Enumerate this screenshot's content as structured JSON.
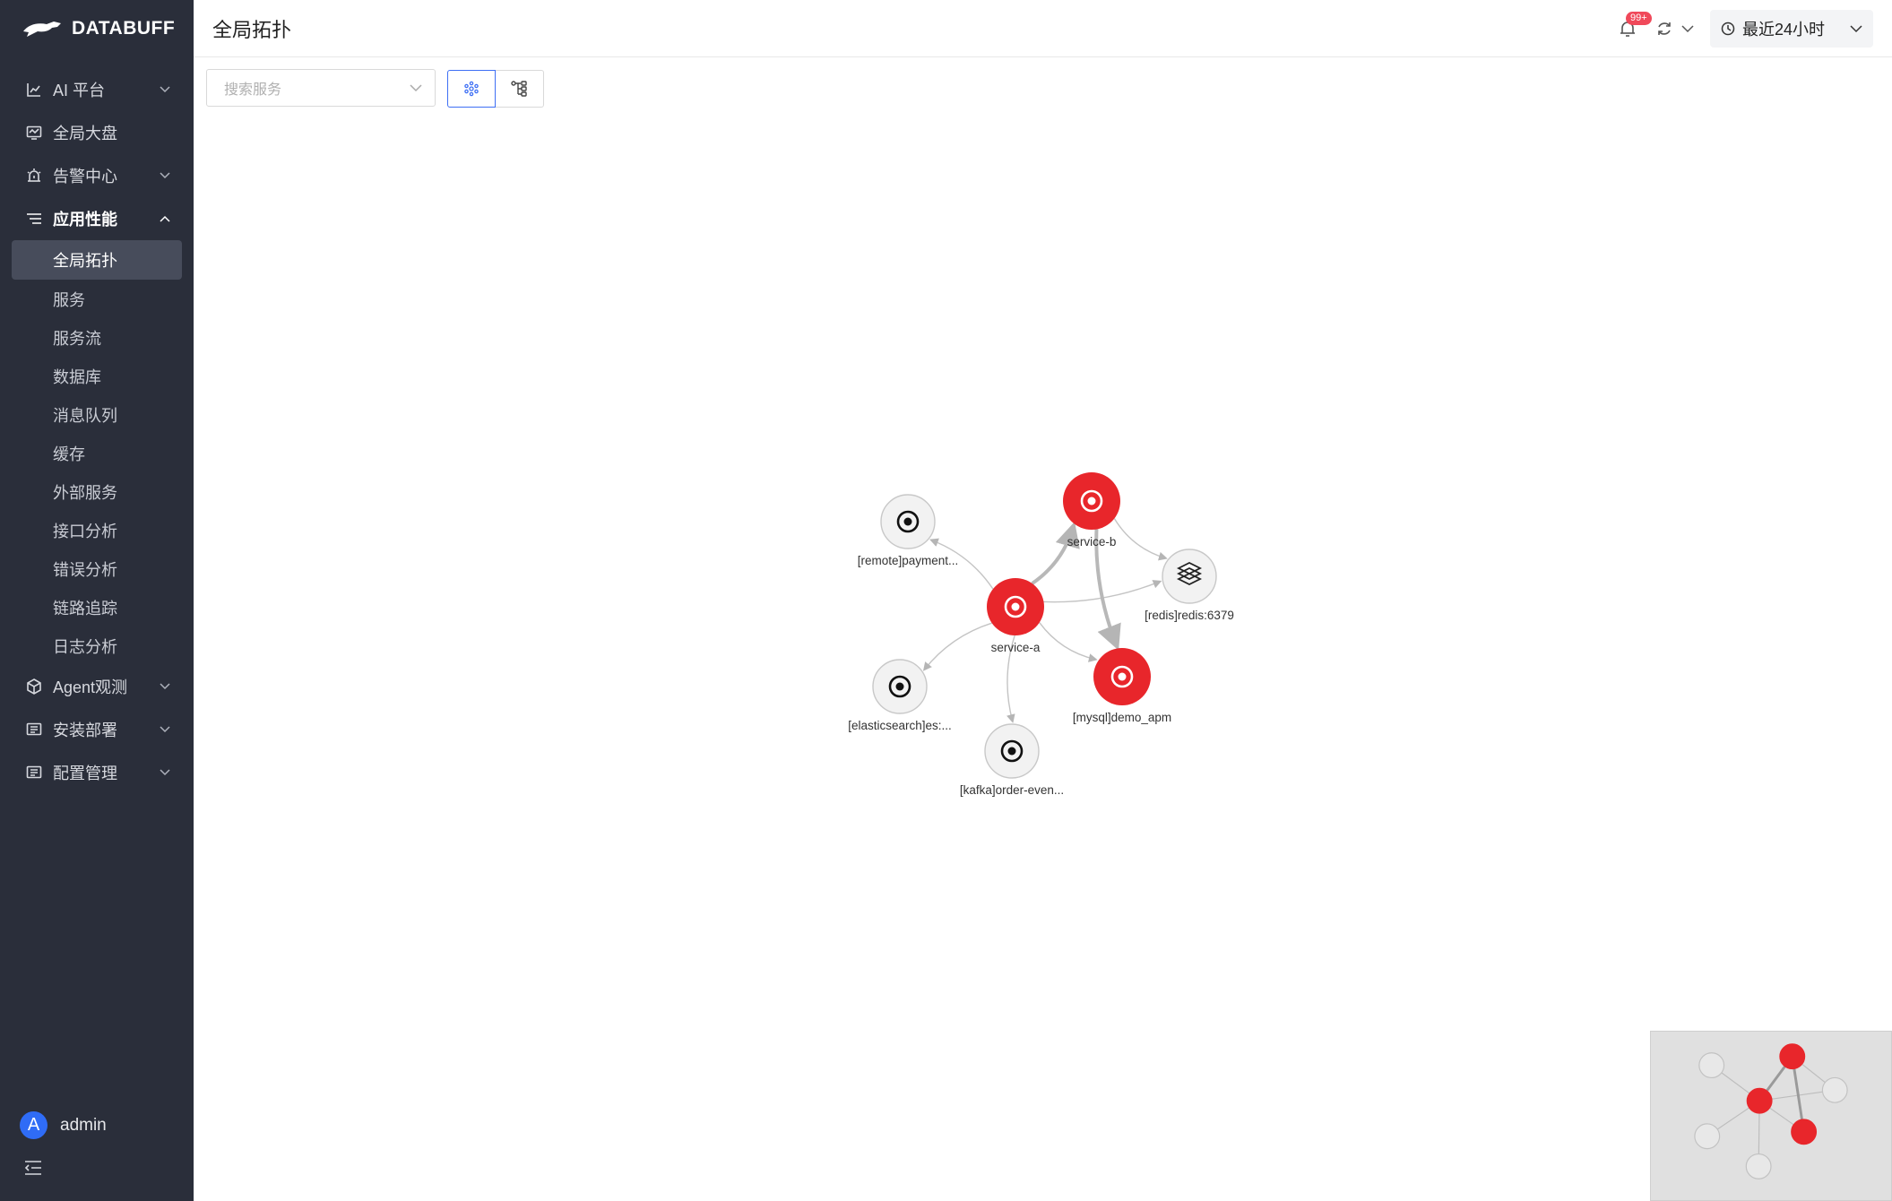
{
  "brand": {
    "logo_text": "DATABUFF"
  },
  "header": {
    "title": "全局拓扑",
    "notification_badge": "99+",
    "time_range": "最近24小时"
  },
  "sidebar": {
    "menu": [
      {
        "label": "AI 平台",
        "icon": "chart-line-icon",
        "expandable": true
      },
      {
        "label": "全局大盘",
        "icon": "dashboard-icon",
        "expandable": false
      },
      {
        "label": "告警中心",
        "icon": "alarm-icon",
        "expandable": true
      },
      {
        "label": "应用性能",
        "icon": "filter-list-icon",
        "expandable": true,
        "open": true
      }
    ],
    "submenu": [
      "全局拓扑",
      "服务",
      "服务流",
      "数据库",
      "消息队列",
      "缓存",
      "外部服务",
      "接口分析",
      "错误分析",
      "链路追踪",
      "日志分析"
    ],
    "menu_bottom": [
      {
        "label": "Agent观测",
        "icon": "cube-icon",
        "expandable": true
      },
      {
        "label": "安装部署",
        "icon": "list-box-icon",
        "expandable": true
      },
      {
        "label": "配置管理",
        "icon": "list-box-icon",
        "expandable": true
      }
    ],
    "user": {
      "name": "admin",
      "initial": "A"
    }
  },
  "toolbar": {
    "search_placeholder": "搜索服务"
  },
  "graph": {
    "nodes": [
      {
        "id": "remote",
        "label": "[remote]payment...",
        "status": "normal",
        "kind": "service"
      },
      {
        "id": "service-b",
        "label": "service-b",
        "status": "error",
        "kind": "service"
      },
      {
        "id": "redis",
        "label": "[redis]redis:6379",
        "status": "normal",
        "kind": "cache"
      },
      {
        "id": "service-a",
        "label": "service-a",
        "status": "error",
        "kind": "service"
      },
      {
        "id": "elastic",
        "label": "[elasticsearch]es:...",
        "status": "normal",
        "kind": "service"
      },
      {
        "id": "mysql",
        "label": "[mysql]demo_apm",
        "status": "error",
        "kind": "service"
      },
      {
        "id": "kafka",
        "label": "[kafka]order-even...",
        "status": "normal",
        "kind": "service"
      }
    ],
    "edges": [
      {
        "from": "service-a",
        "to": "remote",
        "weight": "thin"
      },
      {
        "from": "service-a",
        "to": "service-b",
        "weight": "thick"
      },
      {
        "from": "service-a",
        "to": "redis",
        "weight": "thin"
      },
      {
        "from": "service-a",
        "to": "mysql",
        "weight": "thin"
      },
      {
        "from": "service-a",
        "to": "elastic",
        "weight": "thin"
      },
      {
        "from": "service-a",
        "to": "kafka",
        "weight": "thin"
      },
      {
        "from": "service-b",
        "to": "redis",
        "weight": "thin"
      },
      {
        "from": "service-b",
        "to": "mysql",
        "weight": "thick"
      }
    ]
  },
  "colors": {
    "error": "#e8262b",
    "normal_fill": "#f2f2f2",
    "sidebar_bg": "#2a2e3a",
    "accent": "#3e6ff4"
  }
}
